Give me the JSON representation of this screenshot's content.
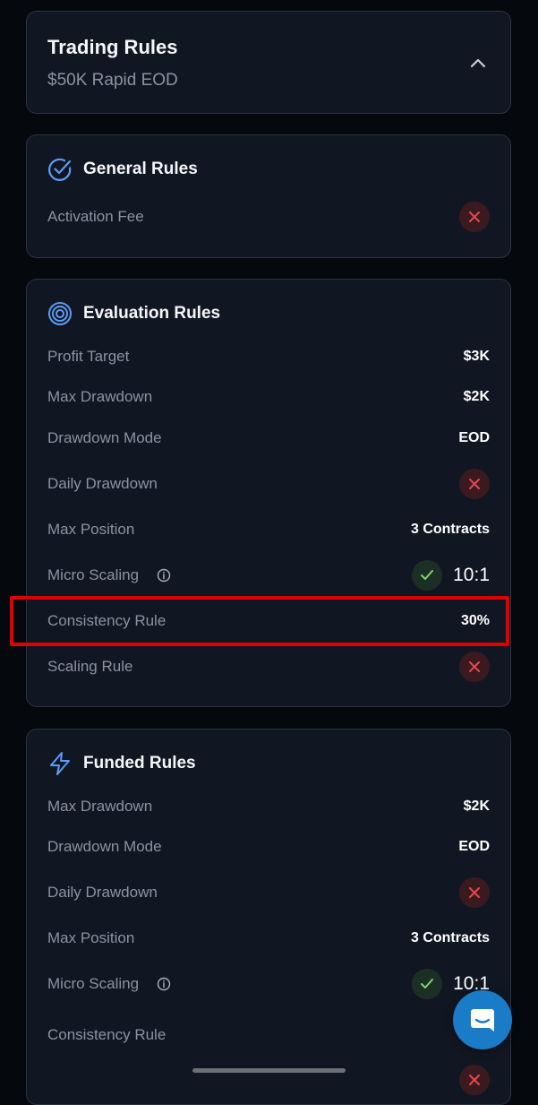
{
  "header": {
    "title": "Trading Rules",
    "subtitle": "$50K Rapid EOD",
    "icon": "chevron-up-icon"
  },
  "general": {
    "title": "General Rules",
    "icon": "check-circle-icon",
    "rows": [
      {
        "label": "Activation Fee",
        "status": "x"
      }
    ]
  },
  "evaluation": {
    "title": "Evaluation Rules",
    "icon": "target-icon",
    "rows": [
      {
        "label": "Profit Target",
        "value": "$3K"
      },
      {
        "label": "Max Drawdown",
        "value": "$2K"
      },
      {
        "label": "Drawdown Mode",
        "value": "EOD"
      },
      {
        "label": "Daily Drawdown",
        "status": "x"
      },
      {
        "label": "Max Position",
        "value": "3 Contracts"
      },
      {
        "label": "Micro Scaling",
        "value": "10:1",
        "status": "check"
      },
      {
        "label": "Consistency Rule",
        "value": "30%"
      },
      {
        "label": "Scaling Rule",
        "status": "x"
      }
    ]
  },
  "funded": {
    "title": "Funded Rules",
    "icon": "lightning-icon",
    "rows": [
      {
        "label": "Max Drawdown",
        "value": "$2K"
      },
      {
        "label": "Drawdown Mode",
        "value": "EOD"
      },
      {
        "label": "Daily Drawdown",
        "status": "x"
      },
      {
        "label": "Max Position",
        "value": "3 Contracts"
      },
      {
        "label": "Micro Scaling",
        "value": "10:1",
        "status": "check"
      },
      {
        "label": "Consistency Rule"
      }
    ]
  },
  "colors": {
    "background": "#05080d",
    "card": "#111722",
    "accent_blue": "#5b9cf5",
    "x_red": "#e5484d",
    "check_green": "#7fd36b",
    "highlight_red": "#e00000",
    "chat_blue": "#1a7bc6"
  }
}
